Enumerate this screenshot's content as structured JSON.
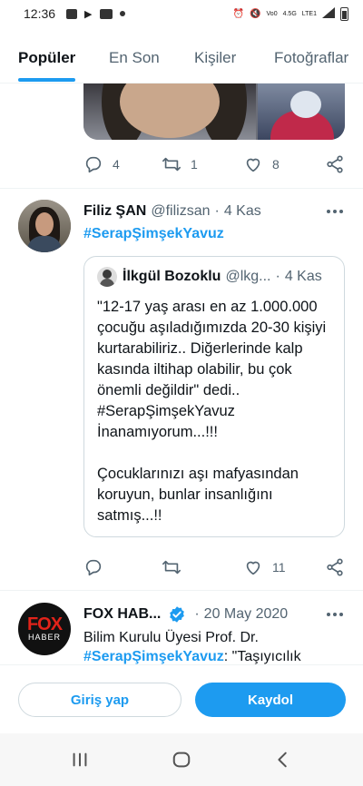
{
  "status_bar": {
    "time": "12:36",
    "network_label": "LTE1",
    "network_speed": "4.5G",
    "volte": "Vo0"
  },
  "tabs": [
    {
      "label": "Popüler",
      "active": true
    },
    {
      "label": "En Son",
      "active": false
    },
    {
      "label": "Kişiler",
      "active": false
    },
    {
      "label": "Fotoğraflar",
      "active": false
    }
  ],
  "tweet0": {
    "replies": "4",
    "retweets": "1",
    "likes": "8"
  },
  "tweet1": {
    "name": "Filiz ŞAN",
    "handle": "@filizsan",
    "separator": "·",
    "date": "4 Kas",
    "hashtag": "#SerapŞimşekYavuz",
    "quote": {
      "name": "İlkgül Bozoklu",
      "handle": "@lkg...",
      "separator": "·",
      "date": "4 Kas",
      "paragraph1": "\"12-17 yaş arası en az 1.000.000 çocuğu aşıladığımızda 20-30 kişiyi kurtarabiliriz.. Diğerlerinde kalp kasında iltihap olabilir, bu çok önemli değildir\" dedi.. #SerapŞimşekYavuz İnanamıyorum...!!!",
      "paragraph2": "Çocuklarınızı aşı mafyasından koruyun, bunlar insanlığını satmış...!!"
    },
    "replies": "",
    "retweets": "",
    "likes": "11"
  },
  "tweet2": {
    "avatar_text_1": "FOX",
    "avatar_text_2": "HABER",
    "name": "FOX HAB...",
    "separator": "·",
    "date": "20 May 2020",
    "text_line1": "Bilim Kurulu Üyesi Prof. Dr.",
    "hashtag": "#SerapŞimşekYavuz",
    "text_after": ": \"Taşıyıcılık"
  },
  "cta": {
    "login_label": "Giriş yap",
    "signup_label": "Kaydol"
  },
  "colors": {
    "accent": "#1d9bf0",
    "text": "#0f1419",
    "muted": "#536471"
  }
}
